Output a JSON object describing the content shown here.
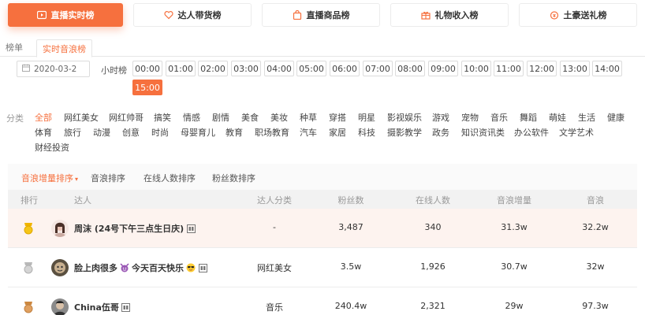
{
  "top_tabs": [
    {
      "label": "直播实时榜",
      "icon": "live-icon",
      "active": true
    },
    {
      "label": "达人带货榜",
      "icon": "heart-tag-icon",
      "active": false
    },
    {
      "label": "直播商品榜",
      "icon": "bag-icon",
      "active": false
    },
    {
      "label": "礼物收入榜",
      "icon": "gift-icon",
      "active": false
    },
    {
      "label": "土豪送礼榜",
      "icon": "coin-icon",
      "active": false
    }
  ],
  "sub_tabs": [
    {
      "label": "榜单",
      "active": false
    },
    {
      "label": "实时音浪榜",
      "active": true
    }
  ],
  "date_value": "2020-03-2",
  "hour_label": "小时榜",
  "hours": [
    "00:00",
    "01:00",
    "02:00",
    "03:00",
    "04:00",
    "05:00",
    "06:00",
    "07:00",
    "08:00",
    "09:00",
    "10:00",
    "11:00",
    "12:00",
    "13:00",
    "14:00",
    "15:00"
  ],
  "active_hour": "15:00",
  "category_label": "分类",
  "categories": [
    "全部",
    "网红美女",
    "网红帅哥",
    "搞笑",
    "情感",
    "剧情",
    "美食",
    "美妆",
    "种草",
    "穿搭",
    "明星",
    "影视娱乐",
    "游戏",
    "宠物",
    "音乐",
    "舞蹈",
    "萌娃",
    "生活",
    "健康",
    "体育",
    "旅行",
    "动漫",
    "创意",
    "时尚",
    "母婴育儿",
    "教育",
    "职场教育",
    "汽车",
    "家居",
    "科技",
    "摄影教学",
    "政务",
    "知识资讯类",
    "办公软件",
    "文学艺术",
    "财经投资"
  ],
  "active_category": "全部",
  "sort_tabs": [
    {
      "label": "音浪增量排序",
      "active": true
    },
    {
      "label": "音浪排序",
      "active": false
    },
    {
      "label": "在线人数排序",
      "active": false
    },
    {
      "label": "粉丝数排序",
      "active": false
    }
  ],
  "columns": [
    "排行",
    "达人",
    "达人分类",
    "粉丝数",
    "在线人数",
    "音浪增量",
    "音浪"
  ],
  "rows": [
    {
      "rank_medal": "gold",
      "name": "周沫 (24号下午三点生日庆)",
      "name_emoji": "",
      "category": "-",
      "fans": "3,487",
      "online": "340",
      "increment": "31.3w",
      "total": "32.2w"
    },
    {
      "rank_medal": "silver",
      "name": "脸上肉很多",
      "name_emoji": "今天百天快乐",
      "category": "网红美女",
      "fans": "3.5w",
      "online": "1,926",
      "increment": "30.7w",
      "total": "32w"
    },
    {
      "rank_medal": "bronze",
      "name": "China伍哥",
      "name_emoji": "",
      "category": "音乐",
      "fans": "240.4w",
      "online": "2,321",
      "increment": "29w",
      "total": "97.3w"
    }
  ],
  "colors": {
    "accent": "#f6703e",
    "gold": "#f5c518",
    "silver": "#c8c8c8",
    "bronze": "#e0a060"
  }
}
